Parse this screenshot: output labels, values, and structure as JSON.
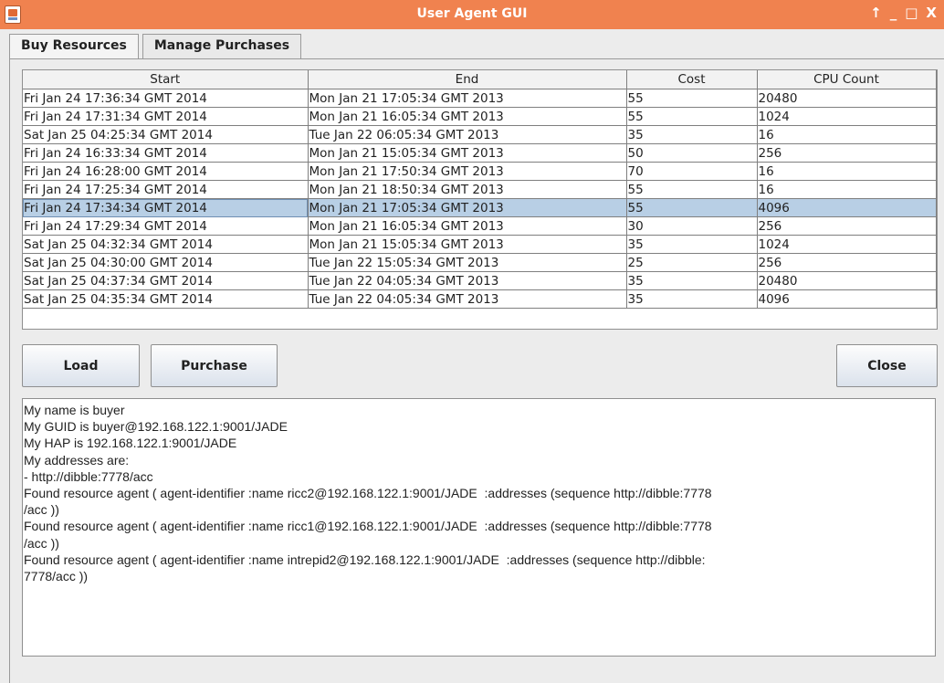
{
  "window": {
    "title": "User Agent GUI",
    "controls": [
      "↑",
      "_",
      "□",
      "X"
    ]
  },
  "tabs": [
    {
      "label": "Buy Resources",
      "active": true
    },
    {
      "label": "Manage Purchases",
      "active": false
    }
  ],
  "table": {
    "columns": [
      "Start",
      "End",
      "Cost",
      "CPU Count"
    ],
    "selected_row": 6,
    "rows": [
      [
        "Fri Jan 24 17:36:34 GMT 2014",
        "Mon Jan 21 17:05:34 GMT 2013",
        "55",
        "20480"
      ],
      [
        "Fri Jan 24 17:31:34 GMT 2014",
        "Mon Jan 21 16:05:34 GMT 2013",
        "55",
        "1024"
      ],
      [
        "Sat Jan 25 04:25:34 GMT 2014",
        "Tue Jan 22 06:05:34 GMT 2013",
        "35",
        "16"
      ],
      [
        "Fri Jan 24 16:33:34 GMT 2014",
        "Mon Jan 21 15:05:34 GMT 2013",
        "50",
        "256"
      ],
      [
        "Fri Jan 24 16:28:00 GMT 2014",
        "Mon Jan 21 17:50:34 GMT 2013",
        "70",
        "16"
      ],
      [
        "Fri Jan 24 17:25:34 GMT 2014",
        "Mon Jan 21 18:50:34 GMT 2013",
        "55",
        "16"
      ],
      [
        "Fri Jan 24 17:34:34 GMT 2014",
        "Mon Jan 21 17:05:34 GMT 2013",
        "55",
        "4096"
      ],
      [
        "Fri Jan 24 17:29:34 GMT 2014",
        "Mon Jan 21 16:05:34 GMT 2013",
        "30",
        "256"
      ],
      [
        "Sat Jan 25 04:32:34 GMT 2014",
        "Mon Jan 21 15:05:34 GMT 2013",
        "35",
        "1024"
      ],
      [
        "Sat Jan 25 04:30:00 GMT 2014",
        "Tue Jan 22 15:05:34 GMT 2013",
        "25",
        "256"
      ],
      [
        "Sat Jan 25 04:37:34 GMT 2014",
        "Tue Jan 22 04:05:34 GMT 2013",
        "35",
        "20480"
      ],
      [
        "Sat Jan 25 04:35:34 GMT 2014",
        "Tue Jan 22 04:05:34 GMT 2013",
        "35",
        "4096"
      ]
    ]
  },
  "buttons": {
    "load": "Load",
    "purchase": "Purchase",
    "close": "Close"
  },
  "log": {
    "lines": [
      "My name is buyer",
      "My GUID is buyer@192.168.122.1:9001/JADE",
      "My HAP is 192.168.122.1:9001/JADE",
      "My addresses are:",
      "- http://dibble:7778/acc",
      "Found resource agent ( agent-identifier :name ricc2@192.168.122.1:9001/JADE  :addresses (sequence http://dibble:7778",
      "/acc ))",
      "Found resource agent ( agent-identifier :name ricc1@192.168.122.1:9001/JADE  :addresses (sequence http://dibble:7778",
      "/acc ))",
      "Found resource agent ( agent-identifier :name intrepid2@192.168.122.1:9001/JADE  :addresses (sequence http://dibble:",
      "7778/acc ))"
    ]
  }
}
